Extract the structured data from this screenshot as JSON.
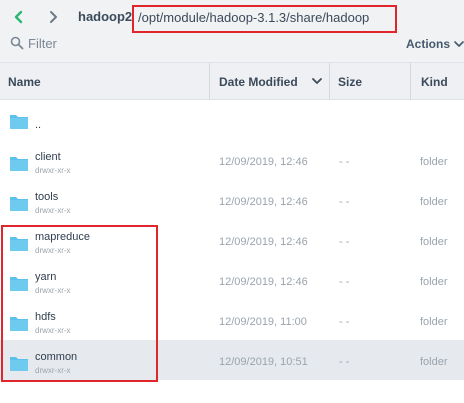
{
  "toolbar": {
    "host": "hadoop2",
    "path": "/opt/module/hadoop-3.1.3/share/hadoop",
    "filter_label": "Filter",
    "actions_label": "Actions"
  },
  "columns": {
    "name": "Name",
    "date_modified": "Date Modified",
    "size": "Size",
    "kind": "Kind"
  },
  "files": [
    {
      "name": "..",
      "perm": "",
      "date": "",
      "size": "",
      "kind": ""
    },
    {
      "name": "client",
      "perm": "drwxr-xr-x",
      "date": "12/09/2019, 12:46",
      "size": "- -",
      "kind": "folder"
    },
    {
      "name": "tools",
      "perm": "drwxr-xr-x",
      "date": "12/09/2019, 12:46",
      "size": "- -",
      "kind": "folder"
    },
    {
      "name": "mapreduce",
      "perm": "drwxr-xr-x",
      "date": "12/09/2019, 12:46",
      "size": "- -",
      "kind": "folder"
    },
    {
      "name": "yarn",
      "perm": "drwxr-xr-x",
      "date": "12/09/2019, 12:46",
      "size": "- -",
      "kind": "folder"
    },
    {
      "name": "hdfs",
      "perm": "drwxr-xr-x",
      "date": "12/09/2019, 11:00",
      "size": "- -",
      "kind": "folder"
    },
    {
      "name": "common",
      "perm": "drwxr-xr-x",
      "date": "12/09/2019, 10:51",
      "size": "- -",
      "kind": "folder"
    }
  ],
  "colors": {
    "accent_green": "#2bb673",
    "folder_blue": "#5bc0ec",
    "annotation_red": "#e0262c",
    "selected_row": "#e6e9ed"
  },
  "icons": {
    "back": "chevron-left-icon",
    "forward": "chevron-right-icon",
    "filter": "search-icon",
    "actions": "chevron-down-icon",
    "sort": "chevron-down-icon",
    "folder": "folder-icon"
  }
}
